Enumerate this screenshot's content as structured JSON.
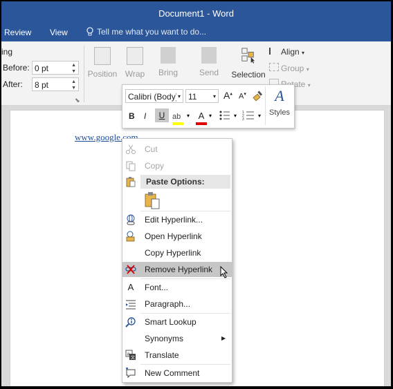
{
  "window": {
    "title": "Document1 - Word"
  },
  "tabs": [
    "Review",
    "View"
  ],
  "tell_me": "Tell me what you want to do...",
  "spacing": {
    "group_label_fragment": "ing",
    "before_label": "Before:",
    "before_value": "0 pt",
    "after_label": "After:",
    "after_value": "8 pt"
  },
  "arrange": {
    "position": "Position",
    "wrap": "Wrap",
    "bring": "Bring",
    "send": "Send",
    "selection": "Selection",
    "align": "Align",
    "group": "Group",
    "rotate": "Rotate"
  },
  "document": {
    "link_text": "www.google.com"
  },
  "minibar": {
    "font": "Calibri (Body)",
    "size": "11",
    "styles": "Styles",
    "bold": "B",
    "italic": "I",
    "underline": "U"
  },
  "context_menu": {
    "cut": "Cut",
    "copy": "Copy",
    "paste_options": "Paste Options:",
    "edit_hyperlink": "Edit Hyperlink...",
    "open_hyperlink": "Open Hyperlink",
    "copy_hyperlink": "Copy Hyperlink",
    "remove_hyperlink": "Remove Hyperlink",
    "font": "Font...",
    "paragraph": "Paragraph...",
    "smart_lookup": "Smart Lookup",
    "synonyms": "Synonyms",
    "translate": "Translate",
    "new_comment": "New Comment"
  },
  "colors": {
    "title_bar": "#2b579a",
    "highlight_color": "#ffff00",
    "font_color": "#e00000",
    "hover_row": "#c6c6c6"
  }
}
